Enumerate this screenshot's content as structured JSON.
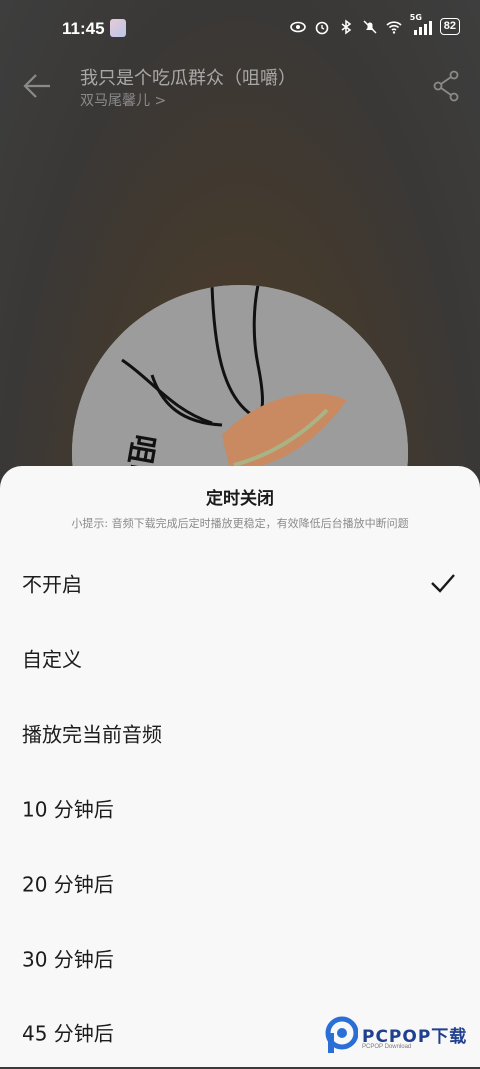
{
  "status_bar": {
    "time": "11:45",
    "icons": [
      "eye-icon",
      "alarm-icon",
      "bluetooth-icon",
      "mute-icon",
      "wifi-icon",
      "signal-icon"
    ],
    "network": "5G",
    "battery": "82"
  },
  "player": {
    "title": "我只是个吃瓜群众（咀嚼）",
    "artist": "双马尾馨儿 >",
    "album_text": "咀嚼"
  },
  "sheet": {
    "title": "定时关闭",
    "hint": "小提示: 音频下载完成后定时播放更稳定，有效降低后台播放中断问题",
    "options": [
      {
        "label": "不开启",
        "selected": true
      },
      {
        "label": "自定义",
        "selected": false
      },
      {
        "label": "播放完当前音频",
        "selected": false
      },
      {
        "label": "10 分钟后",
        "selected": false
      },
      {
        "label": "20 分钟后",
        "selected": false
      },
      {
        "label": "30 分钟后",
        "selected": false
      },
      {
        "label": "45 分钟后",
        "selected": false
      }
    ]
  },
  "watermark": {
    "text": "PCPOP下载",
    "sub": "PCPOP Download"
  },
  "colors": {
    "sheet_bg": "#f8f8f8",
    "overlay": "#3b3b3b",
    "watermark": "#1f3f8f"
  }
}
